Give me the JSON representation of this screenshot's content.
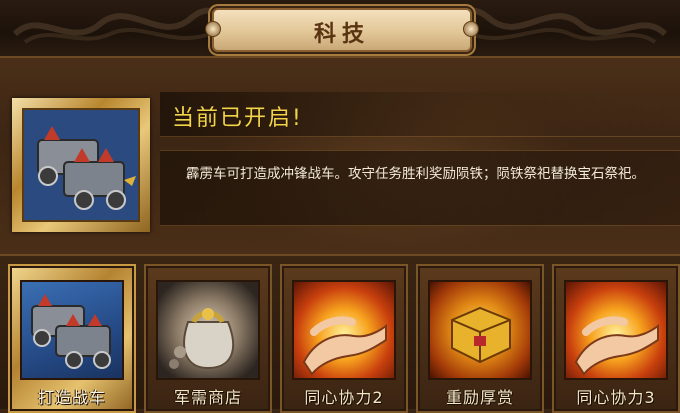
{
  "header": {
    "title": "科技"
  },
  "info": {
    "status": "当前已开启!",
    "description": "霹雳车可打造成冲锋战车。攻守任务胜利奖励陨铁；陨铁祭祀替换宝石祭祀。",
    "icon": "war-chariot-icon"
  },
  "items": [
    {
      "label": "打造战车",
      "icon": "war-chariot-icon",
      "selected": true
    },
    {
      "label": "军需商店",
      "icon": "money-bag-icon",
      "selected": false
    },
    {
      "label": "同心协力2",
      "icon": "flaming-hands-icon",
      "selected": false
    },
    {
      "label": "重励厚赏",
      "icon": "golden-chest-icon",
      "selected": false
    },
    {
      "label": "同心协力3",
      "icon": "flaming-hands-icon",
      "selected": false
    }
  ],
  "colors": {
    "status_text": "#f0d44a",
    "selected_frame": "#c99a44",
    "background": "#3a2413"
  }
}
